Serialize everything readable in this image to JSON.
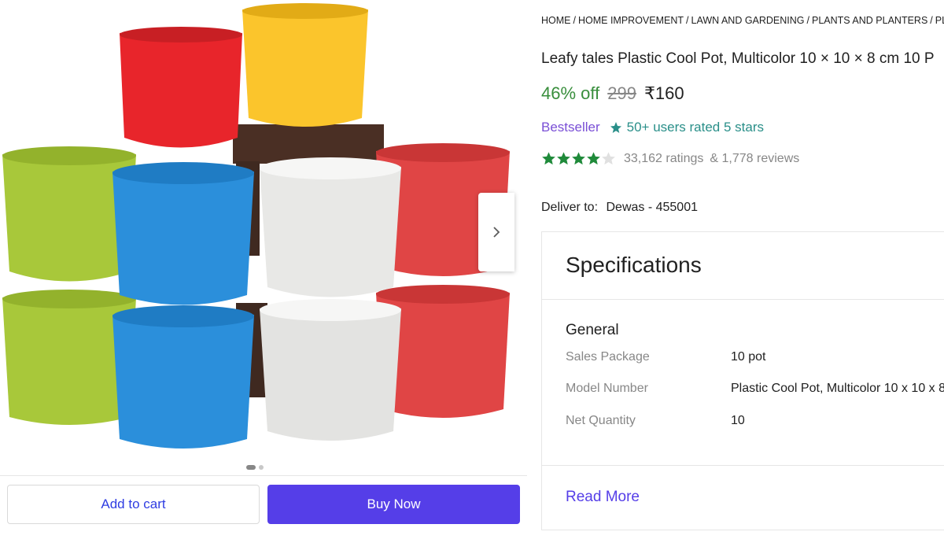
{
  "breadcrumb": [
    "HOME",
    "HOME IMPROVEMENT",
    "LAWN AND GARDENING",
    "PLANTS AND PLANTERS",
    "PLAN"
  ],
  "product": {
    "title": "Leafy tales Plastic Cool Pot, Multicolor 10 × 10 × 8 cm 10 P",
    "discount": "46% off",
    "mrp": "299",
    "price": "₹160",
    "badge": "Bestseller",
    "rated_text": "50+ users rated 5 stars",
    "rating_value": 4,
    "ratings_count": "33,162 ratings",
    "reviews_count": "& 1,778 reviews"
  },
  "delivery": {
    "label": "Deliver to:",
    "location": "Dewas - 455001"
  },
  "specifications": {
    "heading": "Specifications",
    "section": "General",
    "rows": [
      {
        "key": "Sales Package",
        "value": "10 pot"
      },
      {
        "key": "Model Number",
        "value": "Plastic Cool Pot, Multicolor 10 x 10 x 8"
      },
      {
        "key": "Net Quantity",
        "value": "10"
      }
    ],
    "read_more": "Read More"
  },
  "actions": {
    "add_to_cart": "Add to cart",
    "buy_now": "Buy Now"
  },
  "gallery": {
    "image_count": 2,
    "active_index": 0,
    "pot_colors": [
      "#e8252b",
      "#fbc52c",
      "#a8c83a",
      "#2b8fdb",
      "#e8e8e6",
      "#e04545",
      "#5a3a2c"
    ]
  },
  "colors": {
    "accent": "#553ee8",
    "discount": "#388e3c",
    "star": "#1f8a3a",
    "bestseller": "#7a4fd6",
    "rated": "#2a8f89"
  }
}
